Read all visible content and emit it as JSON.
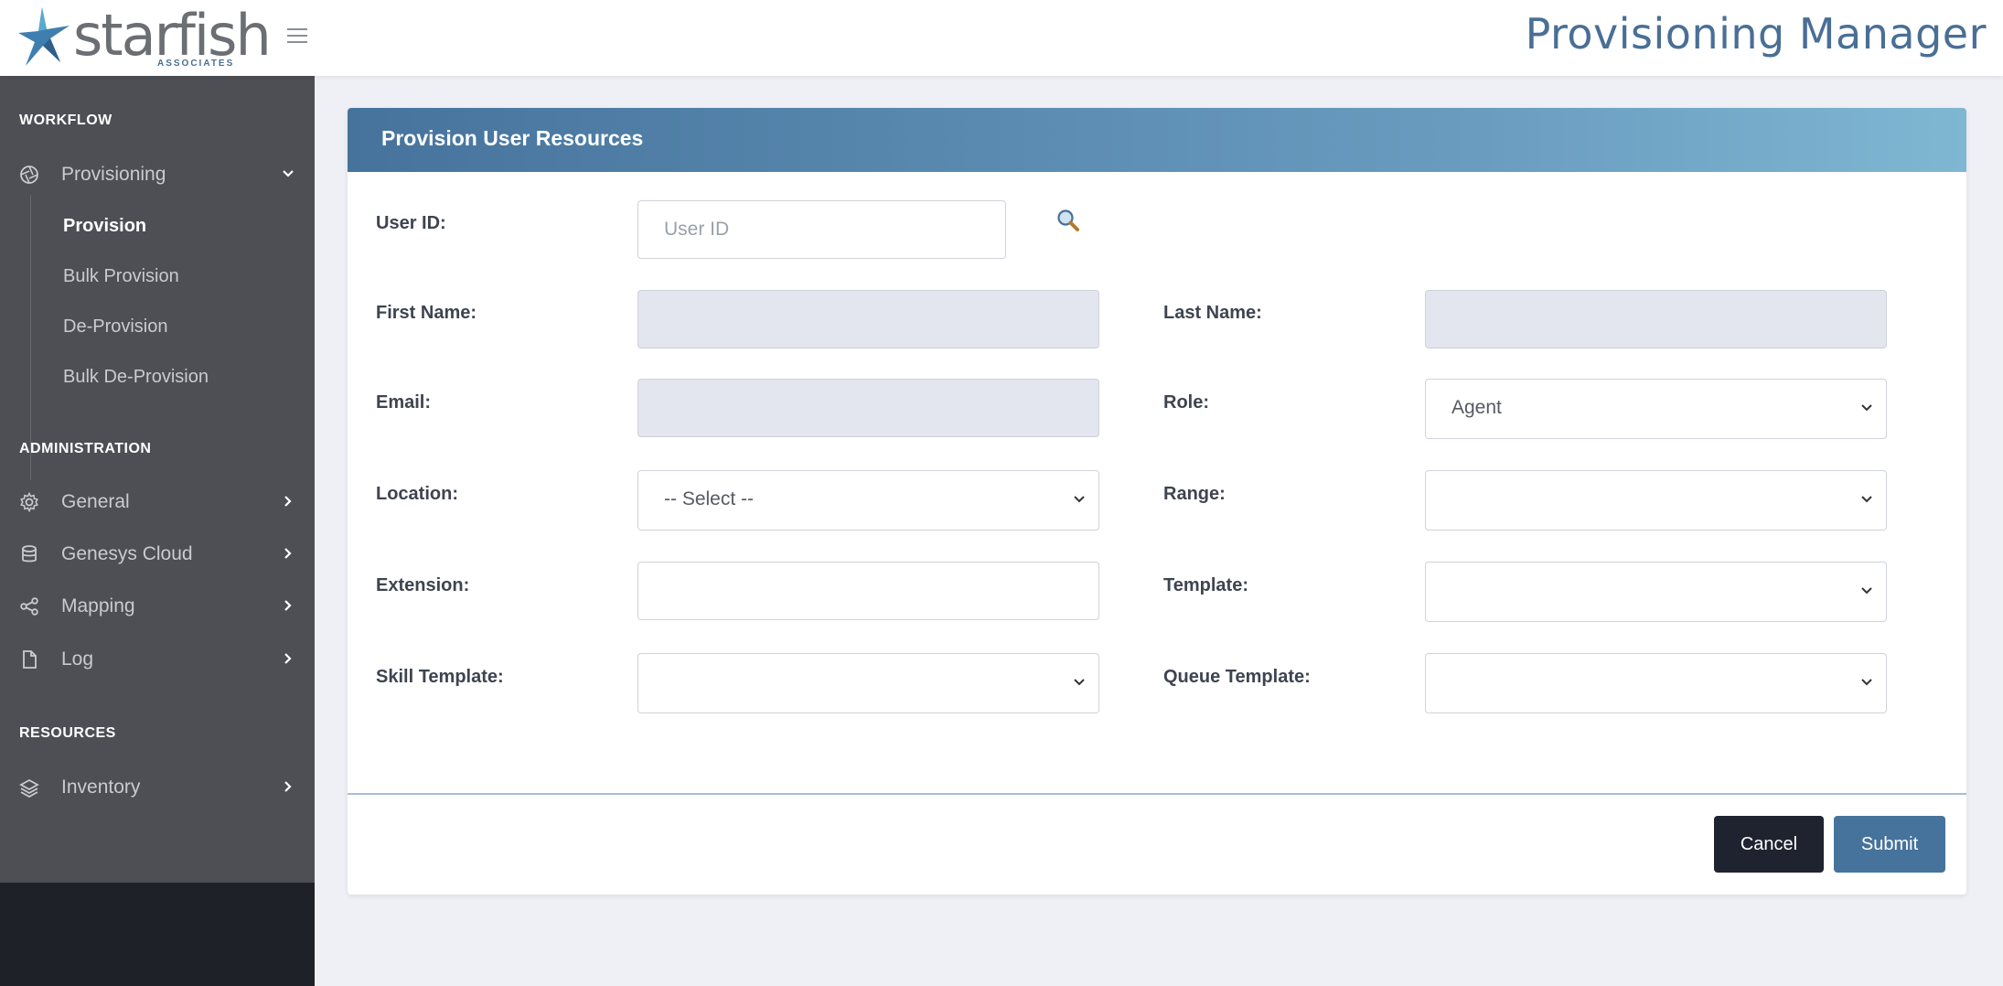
{
  "header": {
    "logo_text": "starfish",
    "logo_subtext": "ASSOCIATES",
    "app_title": "Provisioning Manager"
  },
  "sidebar": {
    "sections": [
      {
        "label": "WORKFLOW",
        "items": [
          {
            "label": "Provisioning",
            "icon": "aperture-icon",
            "expanded": true,
            "children": [
              "Provision",
              "Bulk Provision",
              "De-Provision",
              "Bulk De-Provision"
            ],
            "active_child": "Provision"
          }
        ]
      },
      {
        "label": "ADMINISTRATION",
        "items": [
          {
            "label": "General",
            "icon": "gear-icon"
          },
          {
            "label": "Genesys Cloud",
            "icon": "database-icon"
          },
          {
            "label": "Mapping",
            "icon": "share-icon"
          },
          {
            "label": "Log",
            "icon": "file-icon"
          }
        ]
      },
      {
        "label": "RESOURCES",
        "items": [
          {
            "label": "Inventory",
            "icon": "layers-icon"
          }
        ]
      }
    ]
  },
  "form": {
    "title": "Provision User Resources",
    "user_id_label": "User ID:",
    "user_id_placeholder": "User ID",
    "user_id_value": "",
    "first_name_label": "First Name:",
    "first_name_value": "",
    "last_name_label": "Last Name:",
    "last_name_value": "",
    "email_label": "Email:",
    "email_value": "",
    "role_label": "Role:",
    "role_value": "Agent",
    "location_label": "Location:",
    "location_value": "-- Select --",
    "range_label": "Range:",
    "range_value": "",
    "extension_label": "Extension:",
    "extension_value": "",
    "template_label": "Template:",
    "template_value": "",
    "skill_template_label": "Skill Template:",
    "skill_template_value": "",
    "queue_template_label": "Queue Template:",
    "queue_template_value": "",
    "cancel_label": "Cancel",
    "submit_label": "Submit"
  },
  "colors": {
    "accent": "#46739c",
    "sidebar_bg": "#4d4f55",
    "sidebar_dark": "#1f2128",
    "cancel_bg": "#1f2330",
    "disabled_field": "#e3e6ee"
  }
}
